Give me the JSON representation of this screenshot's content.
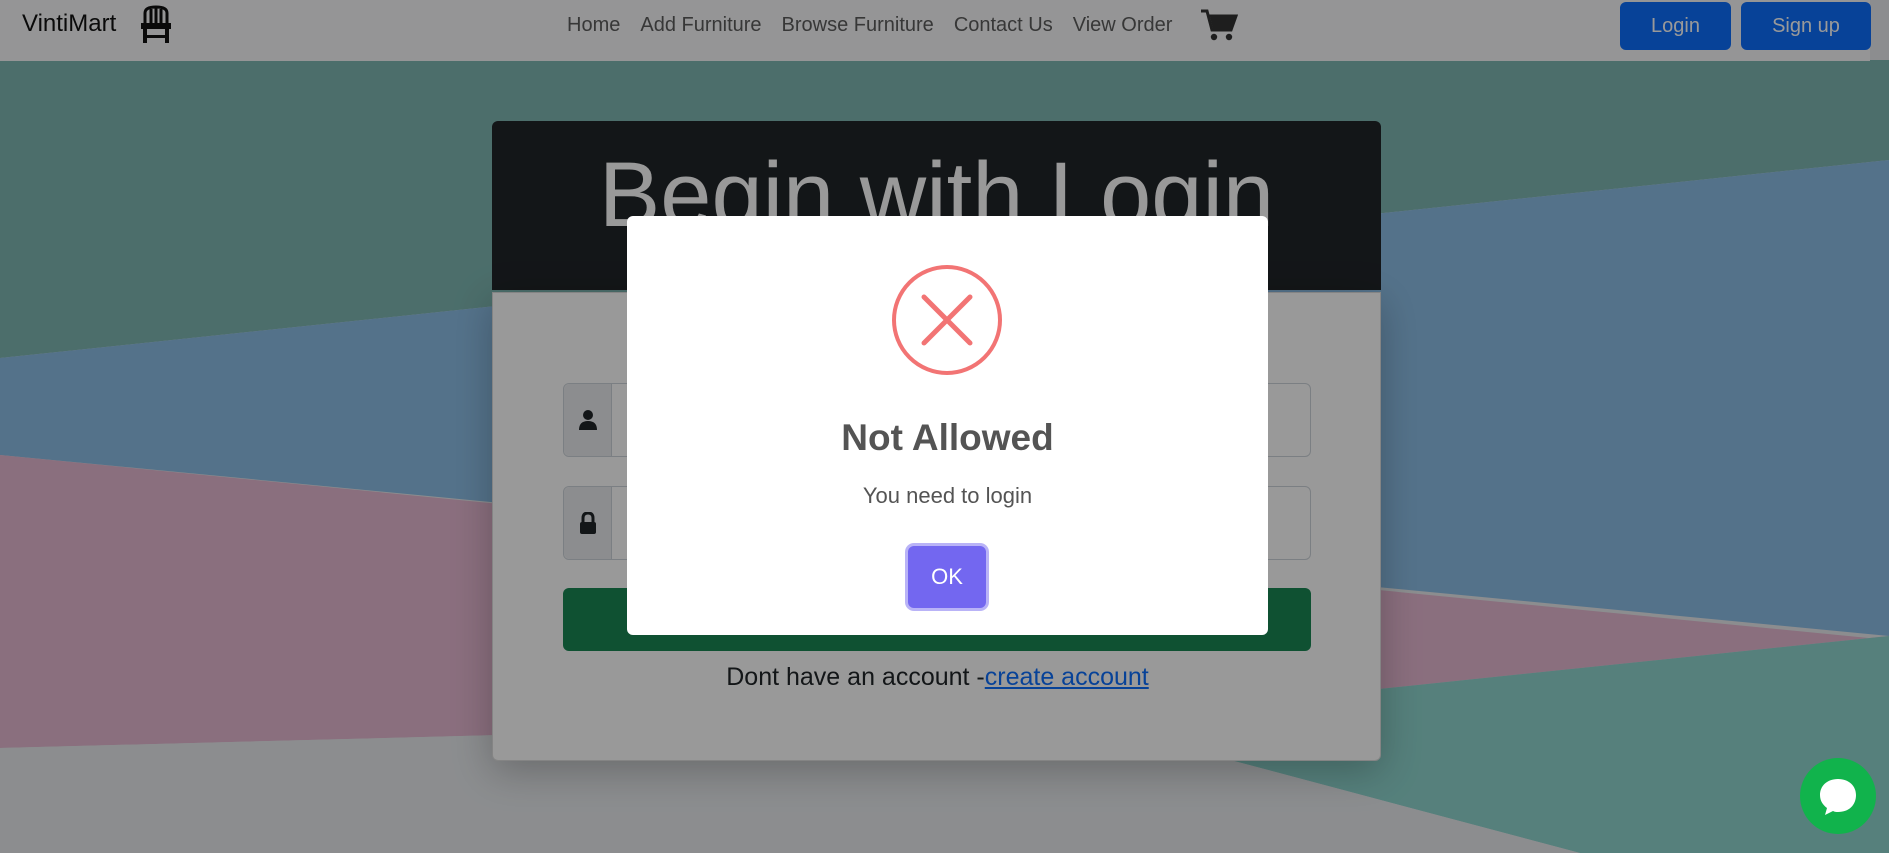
{
  "navbar": {
    "brand": "VintiMart",
    "brand_icon": "chair-icon",
    "links": [
      "Home",
      "Add Furniture",
      "Browse Furniture",
      "Contact Us",
      "View Order"
    ],
    "cart_icon": "cart-icon",
    "login_label": "Login",
    "signup_label": "Sign up"
  },
  "login_card": {
    "title": "Begin with Login",
    "username_icon": "user-icon",
    "password_icon": "lock-icon",
    "submit_label": "",
    "signup_prompt": "Dont have an account -",
    "signup_link": "create account"
  },
  "modal": {
    "icon": "error-x-icon",
    "title": "Not Allowed",
    "text": "You need to login",
    "ok_label": "OK"
  },
  "chat": {
    "icon": "chat-icon"
  },
  "colors": {
    "primary": "#0d6efd",
    "success": "#198754",
    "dark": "#212529",
    "modal_confirm": "#7367f0",
    "error": "#f27474",
    "chat": "#11b34c"
  }
}
